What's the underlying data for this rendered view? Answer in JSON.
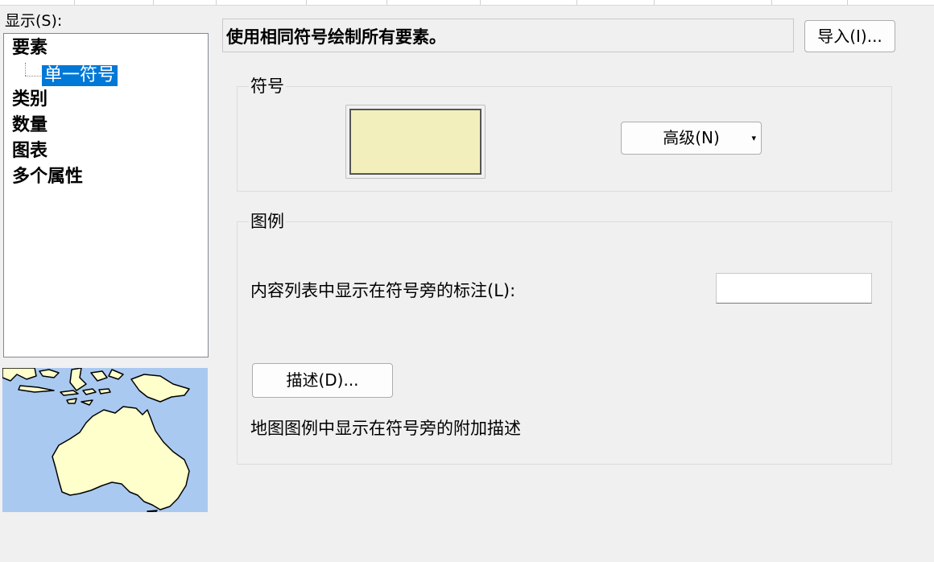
{
  "display": {
    "label": "显示(S):",
    "tree": {
      "items": [
        "要素",
        "类别",
        "数量",
        "图表",
        "多个属性"
      ],
      "selected_child": "单一符号"
    }
  },
  "main": {
    "description": "使用相同符号绘制所有要素。",
    "import_button": "导入(I)...",
    "symbol": {
      "title": "符号",
      "fill_color": "#f3efbd",
      "advanced_button": "高级(N)",
      "advanced_caret": "▾"
    },
    "legend": {
      "title": "图例",
      "label_text": "内容列表中显示在符号旁的标注(L):",
      "label_value": "",
      "description_button": "描述(D)...",
      "note": "地图图例中显示在符号旁的附加描述"
    }
  },
  "colors": {
    "selection": "#0078d7",
    "water": "#a9c9f1",
    "land": "#ffffcc"
  }
}
